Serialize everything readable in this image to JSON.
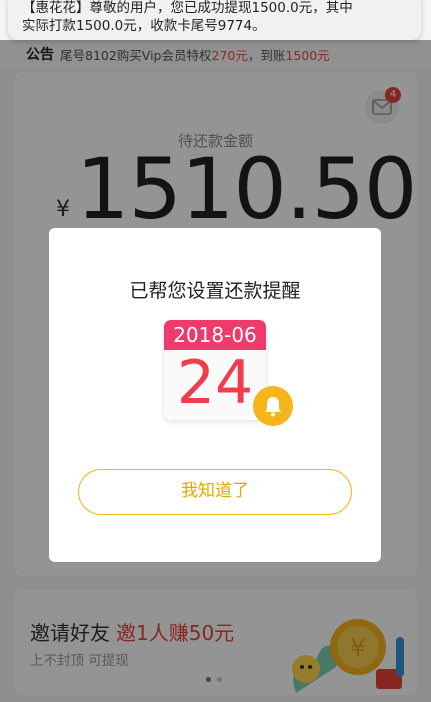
{
  "notification": {
    "line1": "【惠花花】尊敬的用户，您已成功提现1500.0元，其中",
    "line2": "实际打款1500.0元，收款卡尾号9774。"
  },
  "notice": {
    "tag": "公告",
    "text_before": "尾号8102购买Vip会员特权",
    "price": "270元",
    "text_mid": "，到账",
    "received": "1500元"
  },
  "mail": {
    "icon": "mail-icon",
    "badge_count": "4"
  },
  "repay": {
    "label": "待还款金额",
    "currency": "¥",
    "amount": "1510.50"
  },
  "modal": {
    "title": "已帮您设置还款提醒",
    "calendar_month": "2018-06",
    "calendar_day": "24",
    "bell_icon": "bell-icon",
    "confirm_label": "我知道了"
  },
  "invite": {
    "title": "邀请好友",
    "earn": "邀1人赚50元",
    "subtitle": "上不封顶 可提现"
  },
  "colors": {
    "accent_yellow": "#f5b51b",
    "calendar_red": "#ee3b6b",
    "alert_red": "#e8443c"
  }
}
